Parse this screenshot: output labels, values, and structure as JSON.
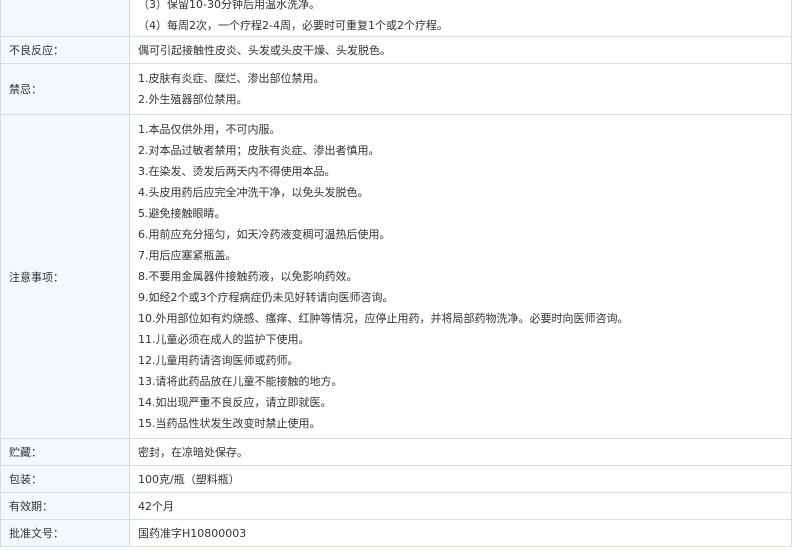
{
  "rows": [
    {
      "label": "",
      "lines": [
        "（3）保留10-30分钟后用温水洗净。",
        "（4）每周2次，一个疗程2-4周，必要时可重复1个或2个疗程。"
      ]
    },
    {
      "label": "不良反应：",
      "lines": [
        "偶可引起接触性皮炎、头发或头皮干燥、头发脱色。"
      ]
    },
    {
      "label": "禁忌：",
      "lines": [
        "1.皮肤有炎症、糜烂、渗出部位禁用。",
        "2.外生殖器部位禁用。"
      ]
    },
    {
      "label": "注意事项：",
      "lines": [
        "1.本品仅供外用，不可内服。",
        "2.对本品过敏者禁用；皮肤有炎症、渗出者慎用。",
        "3.在染发、烫发后两天内不得使用本品。",
        "4.头皮用药后应完全冲洗干净，以免头发脱色。",
        "5.避免接触眼睛。",
        "6.用前应充分摇匀，如天冷药液变稠可温热后使用。",
        "7.用后应塞紧瓶盖。",
        "8.不要用金属器件接触药液，以免影响药效。",
        "9.如经2个或3个疗程病症仍未见好转请向医师咨询。",
        "10.外用部位如有灼烧感、瘙痒、红肿等情况，应停止用药，并将局部药物洗净。必要时向医师咨询。",
        "11.儿童必须在成人的监护下使用。",
        "12.儿童用药请咨询医师或药师。",
        "13.请将此药品放在儿童不能接触的地方。",
        "14.如出现严重不良反应，请立即就医。",
        "15.当药品性状发生改变时禁止使用。"
      ]
    },
    {
      "label": "贮藏：",
      "lines": [
        "密封，在凉暗处保存。"
      ]
    },
    {
      "label": "包装：",
      "lines": [
        "100克/瓶（塑料瓶）"
      ]
    },
    {
      "label": "有效期：",
      "lines": [
        "42个月"
      ]
    },
    {
      "label": "批准文号：",
      "lines": [
        "国药准字H10800003"
      ]
    }
  ]
}
